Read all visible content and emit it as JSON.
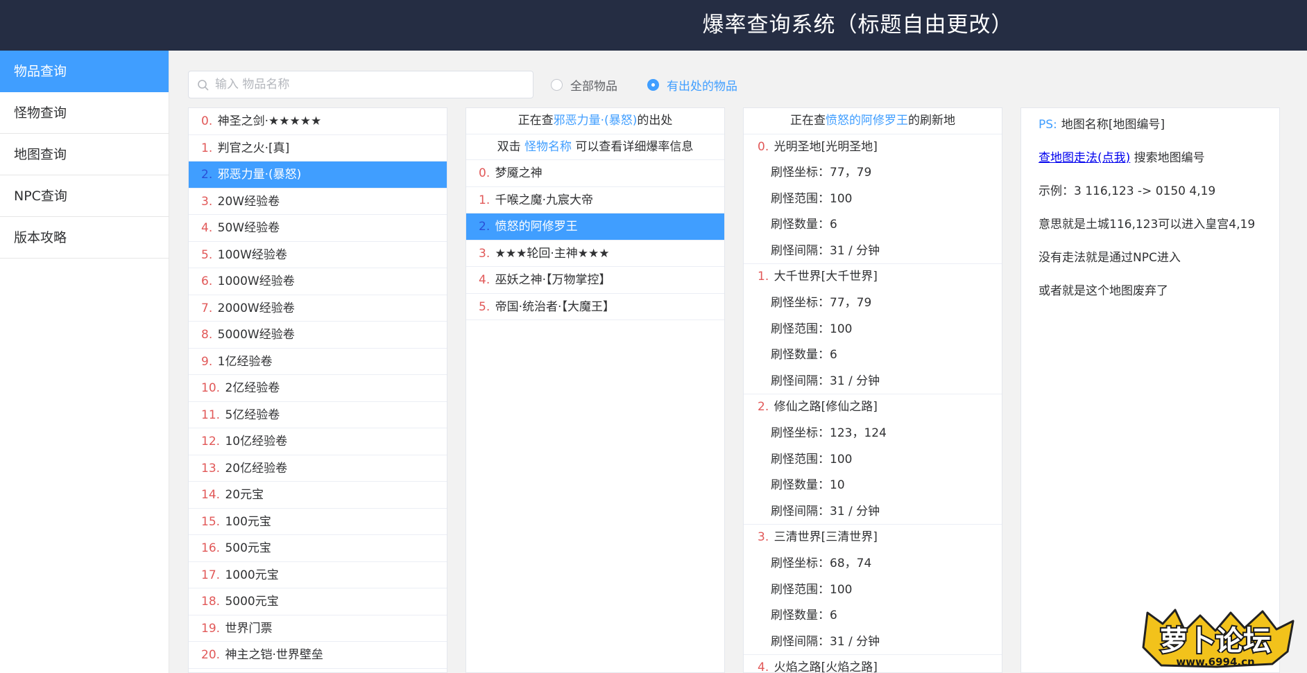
{
  "header": {
    "title": "爆率查询系统（标题自由更改）"
  },
  "sidebar": {
    "items": [
      {
        "label": "物品查询",
        "active": true
      },
      {
        "label": "怪物查询",
        "active": false
      },
      {
        "label": "地图查询",
        "active": false
      },
      {
        "label": "NPC查询",
        "active": false
      },
      {
        "label": "版本攻略",
        "active": false
      }
    ]
  },
  "search": {
    "placeholder": "输入 物品名称",
    "value": ""
  },
  "filters": {
    "all_label": "全部物品",
    "has_source_label": "有出处的物品",
    "selected": "has_source"
  },
  "items": [
    {
      "num": "0.",
      "name": "神圣之剑·★★★★★"
    },
    {
      "num": "1.",
      "name": "判官之火·[真]"
    },
    {
      "num": "2.",
      "name": "邪恶力量·(暴怒)",
      "selected": true
    },
    {
      "num": "3.",
      "name": "20W经验卷"
    },
    {
      "num": "4.",
      "name": "50W经验卷"
    },
    {
      "num": "5.",
      "name": "100W经验卷"
    },
    {
      "num": "6.",
      "name": "1000W经验卷"
    },
    {
      "num": "7.",
      "name": "2000W经验卷"
    },
    {
      "num": "8.",
      "name": "5000W经验卷"
    },
    {
      "num": "9.",
      "name": "1亿经验卷"
    },
    {
      "num": "10.",
      "name": "2亿经验卷"
    },
    {
      "num": "11.",
      "name": "5亿经验卷"
    },
    {
      "num": "12.",
      "name": "10亿经验卷"
    },
    {
      "num": "13.",
      "name": "20亿经验卷"
    },
    {
      "num": "14.",
      "name": "20元宝"
    },
    {
      "num": "15.",
      "name": "100元宝"
    },
    {
      "num": "16.",
      "name": "500元宝"
    },
    {
      "num": "17.",
      "name": "1000元宝"
    },
    {
      "num": "18.",
      "name": "5000元宝"
    },
    {
      "num": "19.",
      "name": "世界门票"
    },
    {
      "num": "20.",
      "name": "神主之铠·世界壁垒"
    }
  ],
  "sources": {
    "head_prefix": "正在查",
    "head_item": "邪恶力量·(暴怒)",
    "head_suffix": "的出处",
    "hint_prefix": "双击",
    "hint_link": "怪物名称",
    "hint_suffix": "可以查看详细爆率信息",
    "monsters": [
      {
        "num": "0.",
        "name": "梦魇之神"
      },
      {
        "num": "1.",
        "name": "千喉之魔·九宸大帝"
      },
      {
        "num": "2.",
        "name": "愤怒的阿修罗王",
        "selected": true
      },
      {
        "num": "3.",
        "name": "★★★轮回·主神★★★"
      },
      {
        "num": "4.",
        "name": "巫妖之神·【万物掌控】"
      },
      {
        "num": "5.",
        "name": "帝国·统治者·【大魔王】"
      }
    ]
  },
  "spawns": {
    "head_prefix": "正在查",
    "head_monster": "愤怒的阿修罗王",
    "head_suffix": "的刷新地",
    "coord_label": "刷怪坐标：",
    "range_label": "刷怪范围：",
    "count_label": "刷怪数量：",
    "interval_label": "刷怪间隔：",
    "maps": [
      {
        "num": "0.",
        "name": "光明圣地[光明圣地]",
        "coord": "77，79",
        "range": "100",
        "count": "6",
        "interval": "31 / 分钟"
      },
      {
        "num": "1.",
        "name": "大千世界[大千世界]",
        "coord": "77，79",
        "range": "100",
        "count": "6",
        "interval": "31 / 分钟"
      },
      {
        "num": "2.",
        "name": "修仙之路[修仙之路]",
        "coord": "123，124",
        "range": "100",
        "count": "10",
        "interval": "31 / 分钟"
      },
      {
        "num": "3.",
        "name": "三清世界[三清世界]",
        "coord": "68，74",
        "range": "100",
        "count": "6",
        "interval": "31 / 分钟"
      },
      {
        "num": "4.",
        "name": "火焰之路[火焰之路]",
        "coord": "",
        "range": "",
        "count": "",
        "interval": ""
      }
    ]
  },
  "ps": {
    "tag": "PS:",
    "line1": "地图名称[地图编号]",
    "link": "查地图走法(点我)",
    "line2_suffix": "搜索地图编号",
    "line3": "示例：3 116,123 -> 0150 4,19",
    "line4": "意思就是土城116,123可以进入皇宫4,19",
    "line5": "没有走法就是通过NPC进入",
    "line6": "或者就是这个地图废弃了"
  },
  "watermark": {
    "text": "萝卜论坛",
    "url": "www.6994.cn"
  },
  "colors": {
    "accent": "#409eff",
    "header_bg": "#252d43",
    "number": "#e15858"
  },
  "icons": {
    "search": "search-icon",
    "radio": "radio-icon"
  }
}
